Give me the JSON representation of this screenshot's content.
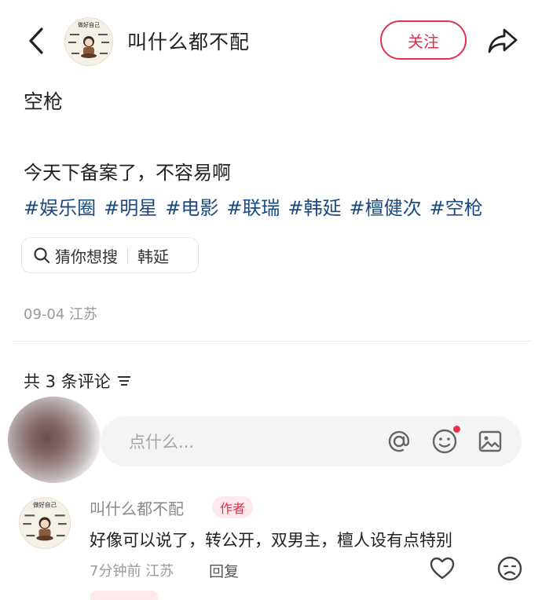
{
  "header": {
    "author_name": "叫什么都不配",
    "follow_label": "关注",
    "avatar_text": "做好自己"
  },
  "post": {
    "title": "空枪",
    "body": "今天下备案了，不容易啊",
    "tags": [
      "#娱乐圈",
      "#明星",
      "#电影",
      "#联瑞",
      "#韩延",
      "#檀健次",
      "#空枪"
    ],
    "guess_label": "猜你想搜",
    "guess_term": "韩延",
    "date_location": "09-04 江苏"
  },
  "comments": {
    "count_label": "共 3 条评论",
    "input_placeholder": "点什么...",
    "items": [
      {
        "name": "叫什么都不配",
        "badge": "作者",
        "text": "好像可以说了，转公开，双男主，檀人设有点特别",
        "time_location": "7分钟前 江苏",
        "reply_label": "回复"
      }
    ]
  },
  "colors": {
    "accent": "#e0314c",
    "tag": "#1b4a82",
    "badge_bg": "#fde8ec"
  }
}
